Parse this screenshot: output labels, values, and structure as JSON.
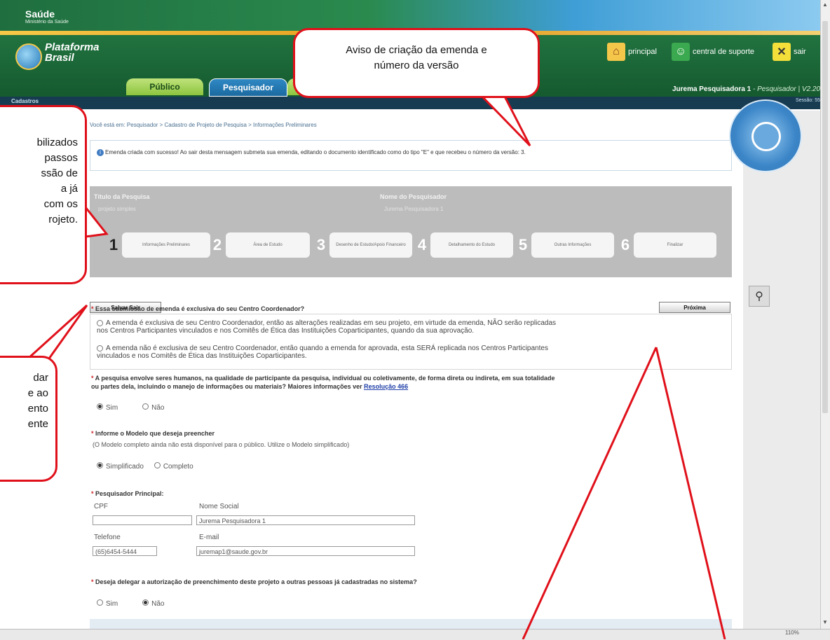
{
  "header": {
    "saude": "Saúde",
    "ministerio": "Ministério da Saúde",
    "logo_line1": "Plataforma",
    "logo_line2": "Brasil",
    "links": [
      {
        "label": "principal",
        "icon": "home-icon"
      },
      {
        "label": "central de suporte",
        "icon": "support-icon"
      },
      {
        "label": "sair",
        "icon": "close-icon"
      }
    ],
    "user_name": "Jurema Pesquisadora 1",
    "user_role": " - Pesquisador | V2.20"
  },
  "tabs": [
    {
      "label": "Público"
    },
    {
      "label": "Pesquisador"
    }
  ],
  "nav": {
    "left": "Cadastros",
    "right": "Sessão: 55"
  },
  "breadcrumb": "Você está em: Pesquisador > Cadastro de Projeto de Pesquisa > Informações Preliminares",
  "message": "Emenda criada com sucesso! Ao sair desta mensagem submeta sua emenda, editando o documento identificado como do tipo \"E\" e que recebeu o número da versão: 3.",
  "project": {
    "title_label": "Título da Pesquisa",
    "title_value": "projeto simples",
    "researcher_label": "Nome do Pesquisador",
    "researcher_value": "Jurema Pesquisadora 1"
  },
  "steps": [
    {
      "num": "1",
      "label": "Informações Preliminares"
    },
    {
      "num": "2",
      "label": "Área de Estudo"
    },
    {
      "num": "3",
      "label": "Desenho de Estudo/Apoio Financeiro"
    },
    {
      "num": "4",
      "label": "Detalhamento do Estudo"
    },
    {
      "num": "5",
      "label": "Outras Informações"
    },
    {
      "num": "6",
      "label": "Finalizar"
    }
  ],
  "buttons": {
    "save_exit": "Salvar Sair",
    "next": "Próxima"
  },
  "questions": {
    "q1": "Essa submissão de emenda é exclusiva do seu Centro Coordenador?",
    "q1_opt1_line1": "A emenda é exclusiva de seu Centro Coordenador, então as alterações realizadas em seu projeto, em virtude da emenda, NÃO serão replicadas",
    "q1_opt1_line2": "nos Centros Participantes vinculados e nos Comitês de Ética das Instituições Coparticipantes, quando da sua aprovação.",
    "q1_opt2_line1": "A emenda não é exclusiva de seu Centro Coordenador, então quando a emenda for aprovada, esta SERÁ replicada nos Centros Participantes",
    "q1_opt2_line2": "vinculados e nos Comitês de Ética das Instituições Coparticipantes.",
    "q2_line1": "A pesquisa envolve seres humanos, na qualidade de participante da pesquisa, individual ou coletivamente, de forma direta ou indireta, em sua totalidade",
    "q2_line2": "ou partes dela, incluindo o manejo de informações ou materiais? Maiores informações ver ",
    "q2_link": "Resolução 466",
    "q3": "Informe o Modelo que deseja preencher",
    "q3_note": "(O Modelo completo ainda não está disponível para o público. Utilize o Modelo simplificado)",
    "q4": "Pesquisador Principal:",
    "q5": "Deseja delegar a autorização de preenchimento deste projeto a outras pessoas já cadastradas no sistema?",
    "sim": "Sim",
    "nao": "Não",
    "simplificado": "Simplificado",
    "completo": "Completo"
  },
  "fields": {
    "cpf_label": "CPF",
    "cpf_value": "",
    "nome_social_label": "Nome Social",
    "nome_social_value": "Jurema Pesquisadora 1",
    "telefone_label": "Telefone",
    "telefone_value": "(65)6454-5444",
    "email_label": "E-mail",
    "email_value": "juremap1@saude.gov.br"
  },
  "statusbar": {
    "zoom": "110%"
  },
  "callouts": {
    "top_line1": "Aviso de criação da emenda e",
    "top_line2": "número da versão",
    "left_line1": "bilizados",
    "left_line2": "passos",
    "left_line3": "ssão de",
    "left_line4": "a já",
    "left_line5": "com os",
    "left_line6": "rojeto.",
    "left2_line1": "dar",
    "left2_line2": "e ao",
    "left2_line3": "ento",
    "left2_line4": "ente"
  },
  "colors": {
    "header_green": "#1a6b3b",
    "tab_blue": "#1b6aa0",
    "callout_red": "#e0101a",
    "required_red": "#d0262b"
  }
}
